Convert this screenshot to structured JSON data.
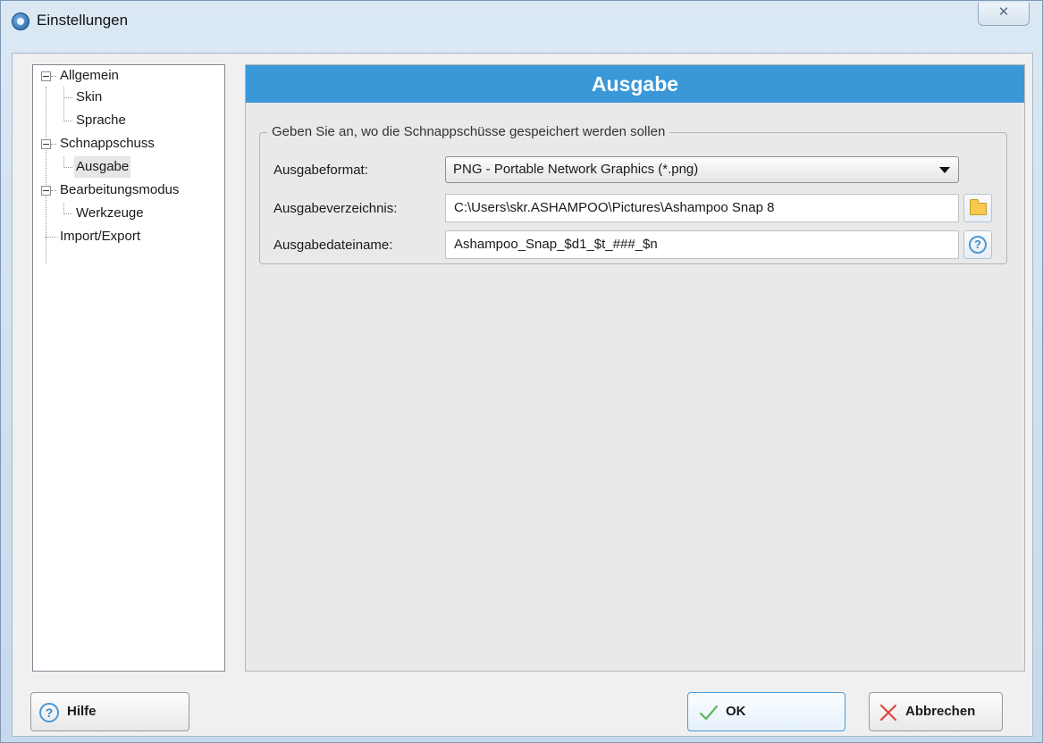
{
  "window": {
    "title": "Einstellungen",
    "close_glyph": "✕"
  },
  "tree": {
    "items": [
      {
        "label": "Allgemein"
      },
      {
        "label": "Skin"
      },
      {
        "label": "Sprache"
      },
      {
        "label": "Schnappschuss"
      },
      {
        "label": "Ausgabe"
      },
      {
        "label": "Bearbeitungsmodus"
      },
      {
        "label": "Werkzeuge"
      },
      {
        "label": "Import/Export"
      }
    ]
  },
  "panel": {
    "header": "Ausgabe",
    "group_legend": "Geben Sie an, wo die Schnappschüsse gespeichert werden sollen",
    "format_label": "Ausgabeformat:",
    "format_value": "PNG - Portable Network Graphics (*.png)",
    "dir_label": "Ausgabeverzeichnis:",
    "dir_value": "C:\\Users\\skr.ASHAMPOO\\Pictures\\Ashampoo Snap 8",
    "filename_label": "Ausgabedateiname:",
    "filename_value": "Ashampoo_Snap_$d1_$t_###_$n"
  },
  "buttons": {
    "help": "Hilfe",
    "ok": "OK",
    "cancel": "Abbrechen",
    "help_glyph": "?"
  }
}
